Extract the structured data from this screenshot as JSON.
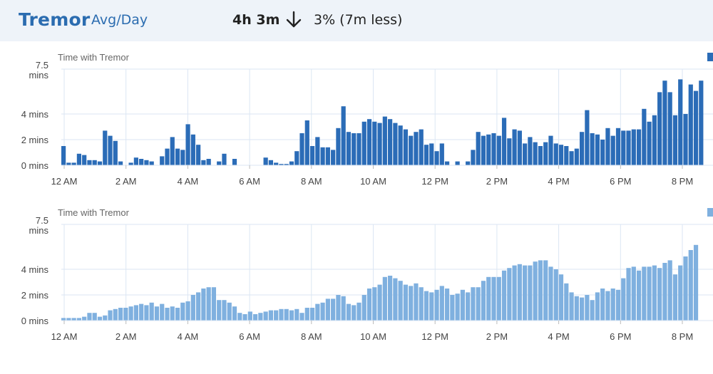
{
  "header": {
    "brand": "Tremor",
    "metric_label": "Avg/Day",
    "total": "4h 3m",
    "change_text": "3% (7m less)",
    "change_direction_icon": "arrow-down-icon"
  },
  "colors": {
    "header_bg": "#eef3f9",
    "brand": "#2b6cb0",
    "bar_dark": "#2b6cb7",
    "bar_light": "#7fb0df",
    "grid": "#dbe6f3"
  },
  "chart_data": [
    {
      "type": "bar",
      "title": "Time with Tremor",
      "color": "#2b6cb7",
      "ylim": [
        0,
        7.5
      ],
      "y_ticks": [
        {
          "value": 7.5,
          "label": [
            "7.5",
            "mins"
          ]
        },
        {
          "value": 4,
          "label": [
            "4 mins"
          ]
        },
        {
          "value": 2,
          "label": [
            "2 mins"
          ]
        },
        {
          "value": 0,
          "label": [
            "0 mins"
          ]
        }
      ],
      "x_ticks": [
        "12 AM",
        "2 AM",
        "4 AM",
        "6 AM",
        "8 AM",
        "10 AM",
        "12 PM",
        "2 PM",
        "4 PM",
        "6 PM",
        "8 PM"
      ],
      "grid": true,
      "legend": "top-right",
      "values": [
        1.5,
        0.2,
        0.2,
        0.9,
        0.8,
        0.4,
        0.4,
        0.3,
        2.7,
        2.3,
        1.9,
        0.3,
        0.0,
        0.2,
        0.6,
        0.5,
        0.4,
        0.3,
        0.0,
        0.7,
        1.3,
        2.2,
        1.3,
        1.2,
        3.2,
        2.4,
        1.6,
        0.4,
        0.5,
        0.0,
        0.3,
        0.9,
        0.0,
        0.5,
        0.0,
        0.0,
        0.0,
        0.0,
        0.0,
        0.6,
        0.4,
        0.2,
        0.1,
        0.1,
        0.3,
        1.1,
        2.5,
        3.5,
        1.5,
        2.2,
        1.4,
        1.4,
        1.2,
        2.9,
        4.6,
        2.6,
        2.5,
        2.5,
        3.4,
        3.6,
        3.4,
        3.3,
        3.8,
        3.6,
        3.3,
        3.1,
        2.8,
        2.3,
        2.6,
        2.8,
        1.6,
        1.7,
        1.1,
        1.7,
        0.3,
        0.0,
        0.3,
        0.0,
        0.3,
        1.2,
        2.6,
        2.3,
        2.4,
        2.5,
        2.3,
        3.7,
        2.1,
        2.8,
        2.7,
        1.7,
        2.2,
        1.8,
        1.5,
        1.8,
        2.3,
        1.7,
        1.6,
        1.5,
        1.1,
        1.3,
        2.6,
        4.3,
        2.5,
        2.4,
        2.0,
        2.9,
        2.3,
        2.9,
        2.7,
        2.7,
        2.8,
        2.8,
        4.4,
        3.4,
        3.9,
        5.7,
        6.6,
        5.7,
        3.9,
        6.7,
        4.0,
        6.3,
        5.8,
        6.6
      ]
    },
    {
      "type": "bar",
      "title": "Time with Tremor",
      "color": "#7fb0df",
      "ylim": [
        0,
        7.5
      ],
      "y_ticks": [
        {
          "value": 7.5,
          "label": [
            "7.5",
            "mins"
          ]
        },
        {
          "value": 4,
          "label": [
            "4 mins"
          ]
        },
        {
          "value": 2,
          "label": [
            "2 mins"
          ]
        },
        {
          "value": 0,
          "label": [
            "0 mins"
          ]
        }
      ],
      "x_ticks": [
        "12 AM",
        "2 AM",
        "4 AM",
        "6 AM",
        "8 AM",
        "10 AM",
        "12 PM",
        "2 PM",
        "4 PM",
        "6 PM",
        "8 PM"
      ],
      "grid": true,
      "legend": "top-right",
      "values": [
        0.2,
        0.2,
        0.2,
        0.2,
        0.3,
        0.6,
        0.6,
        0.3,
        0.4,
        0.8,
        0.9,
        1.0,
        1.0,
        1.1,
        1.2,
        1.3,
        1.2,
        1.4,
        1.1,
        1.3,
        1.0,
        1.1,
        1.0,
        1.4,
        1.5,
        2.0,
        2.2,
        2.5,
        2.6,
        2.6,
        1.6,
        1.6,
        1.4,
        1.1,
        0.6,
        0.5,
        0.7,
        0.5,
        0.6,
        0.7,
        0.8,
        0.8,
        0.9,
        0.9,
        0.8,
        0.9,
        0.6,
        1.0,
        1.0,
        1.3,
        1.4,
        1.7,
        1.7,
        2.0,
        1.9,
        1.3,
        1.2,
        1.4,
        2.0,
        2.5,
        2.6,
        2.8,
        3.4,
        3.5,
        3.3,
        3.1,
        2.8,
        2.7,
        2.9,
        2.6,
        2.3,
        2.2,
        2.4,
        2.7,
        2.5,
        2.0,
        2.1,
        2.4,
        2.2,
        2.6,
        2.6,
        3.1,
        3.4,
        3.4,
        3.4,
        3.9,
        4.1,
        4.3,
        4.4,
        4.3,
        4.3,
        4.6,
        4.7,
        4.7,
        4.2,
        4.0,
        3.6,
        2.9,
        2.2,
        1.9,
        1.8,
        2.0,
        1.6,
        2.2,
        2.5,
        2.3,
        2.5,
        2.4,
        3.3,
        4.1,
        4.2,
        3.9,
        4.2,
        4.2,
        4.3,
        4.1,
        4.5,
        4.7,
        3.6,
        4.3,
        5.0,
        5.5,
        5.9
      ]
    }
  ]
}
